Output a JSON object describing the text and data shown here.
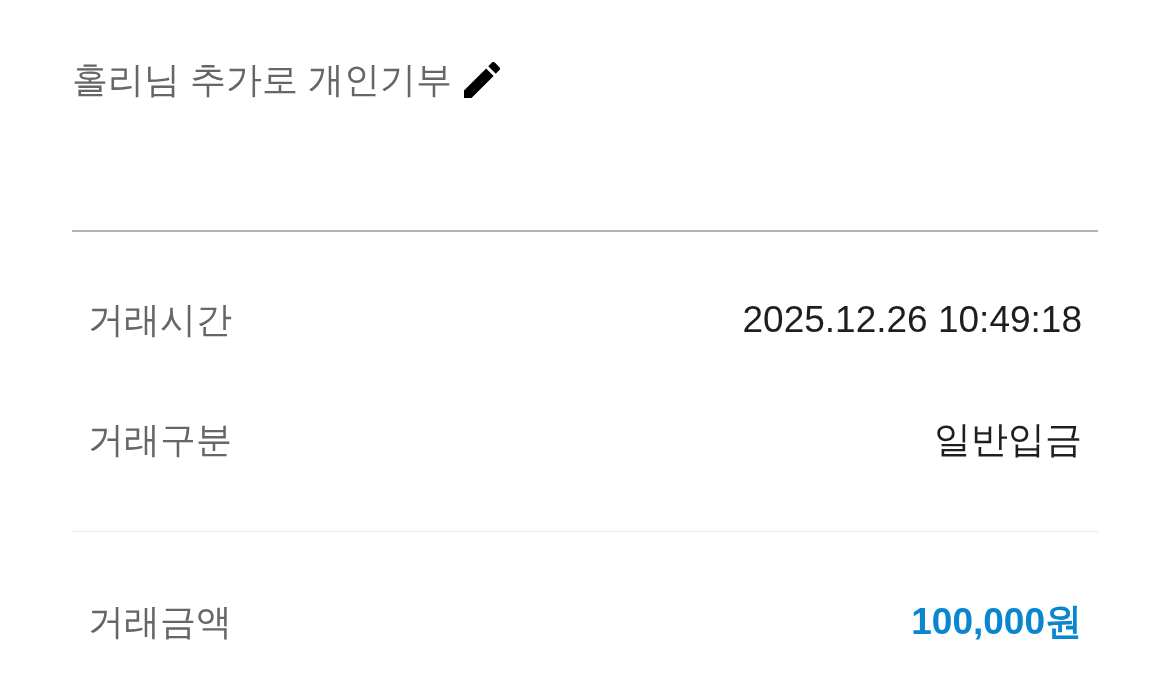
{
  "memo": {
    "text": "홀리님 추가로 개인기부"
  },
  "details": [
    {
      "label": "거래시간",
      "value": "2025.12.26 10:49:18"
    },
    {
      "label": "거래구분",
      "value": "일반입금"
    }
  ],
  "amount": {
    "label": "거래금액",
    "value": "100,000원"
  }
}
